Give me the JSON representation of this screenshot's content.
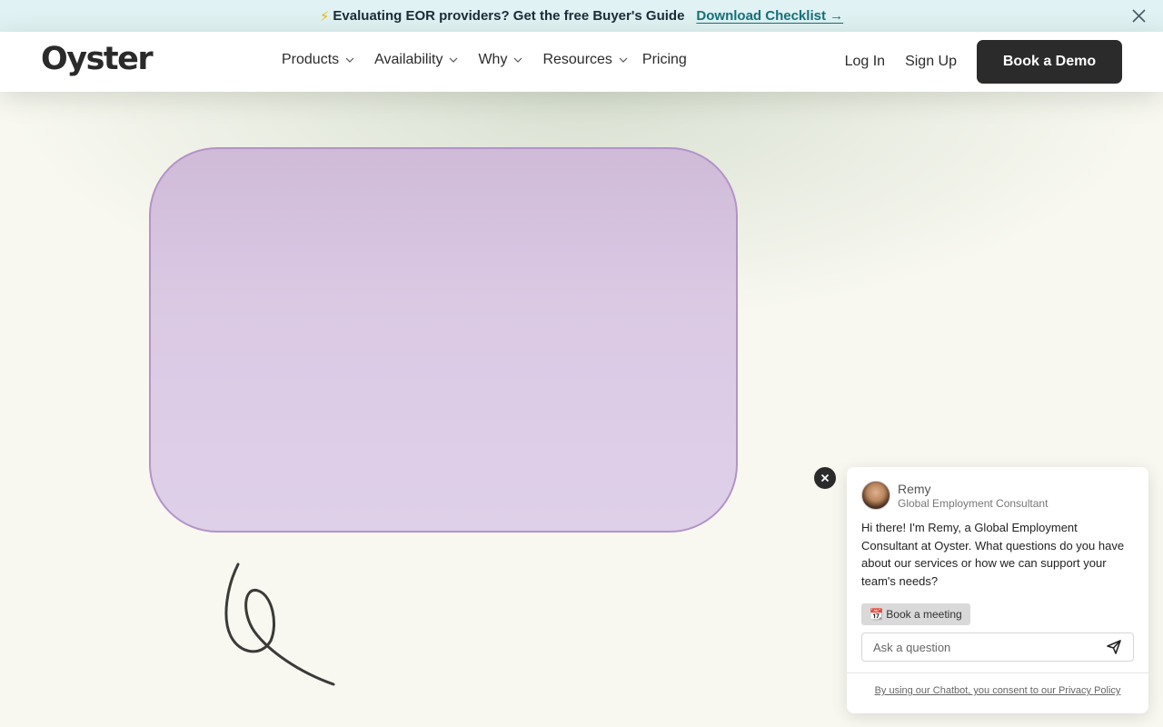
{
  "announcement": {
    "icon": "⚡",
    "message": "Evaluating EOR providers? Get the free Buyer's Guide",
    "link": "Download Checklist →",
    "background": "#e0f2f3",
    "link_color": "#17707a"
  },
  "header": {
    "logo": "Oyster",
    "nav": [
      {
        "label": "Products",
        "dropdown": true
      },
      {
        "label": "Availability",
        "dropdown": true
      },
      {
        "label": "Why",
        "dropdown": true
      },
      {
        "label": "Resources",
        "dropdown": true
      },
      {
        "label": "Pricing",
        "dropdown": false
      }
    ],
    "login": "Log In",
    "signup": "Sign Up",
    "cta": "Book a Demo"
  },
  "hero": {
    "card_border_color": "#b493c8",
    "card_fill_color": "#dbc9e4"
  },
  "chat": {
    "agent_name": "Remy",
    "agent_role": "Global Employment Consultant",
    "greeting": "Hi there! I'm Remy, a Global Employment Consultant at Oyster. What questions do you have about our services or how we can support your team's needs?",
    "meeting_button": "📆 Book a meeting",
    "input_placeholder": "Ask a question",
    "consent": "By using our Chatbot, you consent to our Privacy Policy",
    "close_icon": "close-icon",
    "send_icon": "send-icon"
  }
}
